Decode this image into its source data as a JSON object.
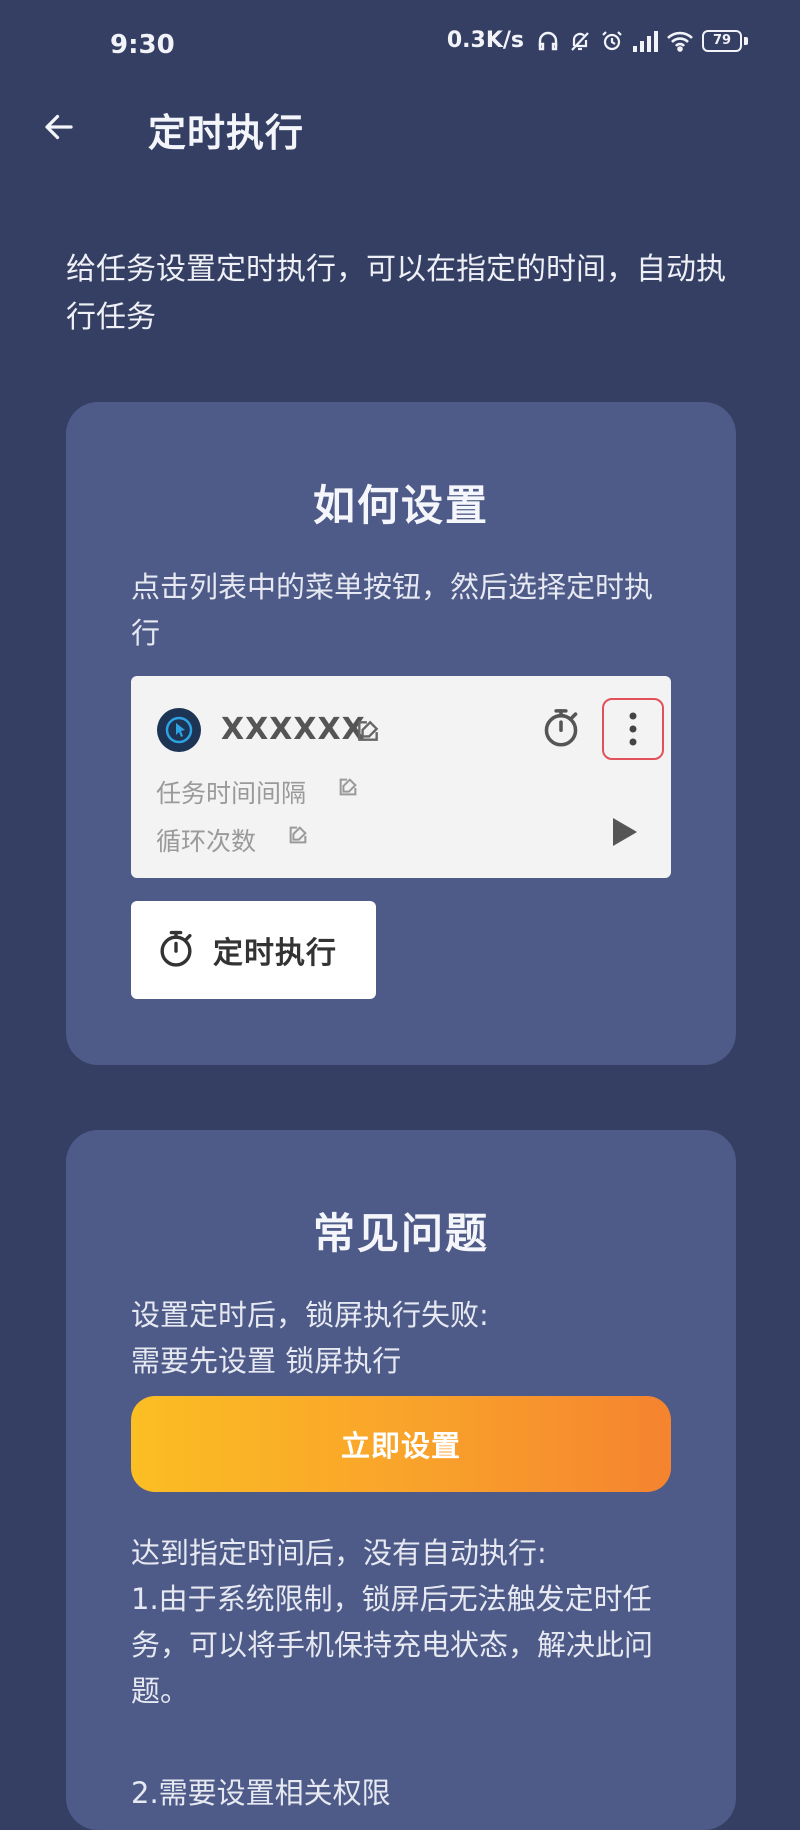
{
  "status_bar": {
    "time": "9:30",
    "net_speed": "0.3K/s",
    "battery_level": "79",
    "icons": [
      "headset-icon",
      "notification-off-icon",
      "alarm-icon",
      "signal-icon",
      "wifi-icon",
      "battery-icon"
    ]
  },
  "app_bar": {
    "title": "定时执行",
    "back_icon": "arrow-left-icon"
  },
  "intro": {
    "text": "给任务设置定时执行，可以在指定的时间，自动执行任务"
  },
  "how_to": {
    "title": "如何设置",
    "description": "点击列表中的菜单按钮，然后选择定时执行",
    "task_item": {
      "name": "XXXXXX",
      "interval_label": "任务时间间隔",
      "loop_label": "循环次数"
    },
    "menu_option": {
      "label": "定时执行"
    }
  },
  "faq": {
    "title": "常见问题",
    "q1_title": "设置定时后，锁屏执行失败:",
    "q1_answer": "需要先设置 锁屏执行",
    "set_now_label": "立即设置",
    "q2_title": "达到指定时间后，没有自动执行:",
    "q2_answer": "1.由于系统限制，锁屏后无法触发定时任务，可以将手机保持充电状态，解决此问题。",
    "q3_partial": "2.需要设置相关权限"
  },
  "colors": {
    "background": "#343f63",
    "card": "#4e5a87",
    "accent_gradient_start": "#fbbe23",
    "accent_gradient_end": "#f5832f",
    "highlight_border": "#e2505a"
  }
}
